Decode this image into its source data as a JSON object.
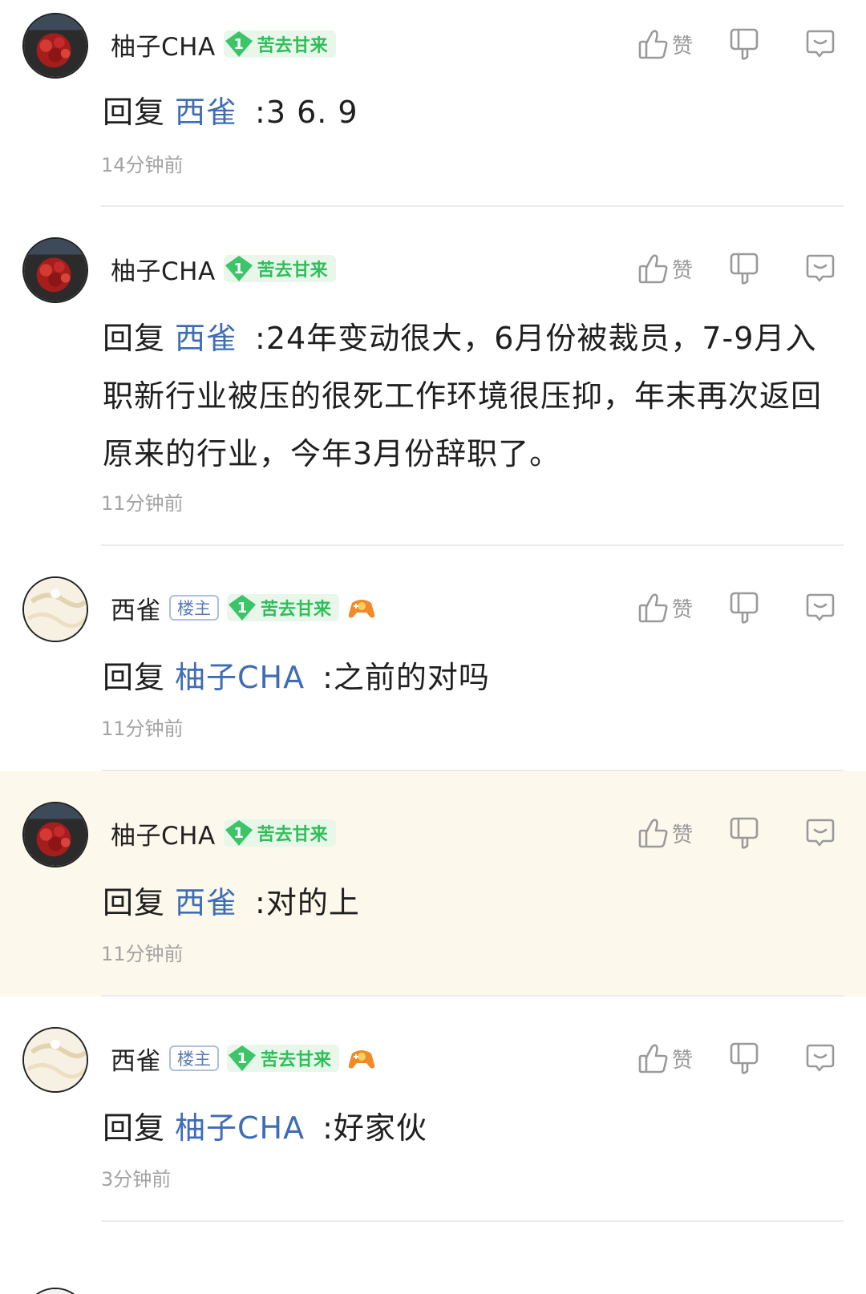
{
  "ui": {
    "reply_prefix": "回复",
    "like_label": "赞",
    "op_badge": "楼主"
  },
  "comments": [
    {
      "user": "柚子CHA",
      "level": "1",
      "level_title": "苦去甘来",
      "is_op": false,
      "reply_to": "西雀",
      "text": ":3 6. 9",
      "time": "14分钟前",
      "highlighted": false
    },
    {
      "user": "柚子CHA",
      "level": "1",
      "level_title": "苦去甘来",
      "is_op": false,
      "reply_to": "西雀",
      "text": ":24年变动很大，6月份被裁员，7-9月入职新行业被压的很死工作环境很压抑，年末再次返回原来的行业，今年3月份辞职了。",
      "time": "11分钟前",
      "highlighted": false
    },
    {
      "user": "西雀",
      "level": "1",
      "level_title": "苦去甘来",
      "is_op": true,
      "reply_to": "柚子CHA",
      "text": ":之前的对吗",
      "time": "11分钟前",
      "highlighted": false
    },
    {
      "user": "柚子CHA",
      "level": "1",
      "level_title": "苦去甘来",
      "is_op": false,
      "reply_to": "西雀",
      "text": ":对的上",
      "time": "11分钟前",
      "highlighted": true
    },
    {
      "user": "西雀",
      "level": "1",
      "level_title": "苦去甘来",
      "is_op": true,
      "reply_to": "柚子CHA",
      "text": ":好家伙",
      "time": "3分钟前",
      "highlighted": false
    }
  ],
  "colors": {
    "mention": "#3f6db5",
    "level_green": "#2fbf5a",
    "highlight_bg": "#fdf8ec"
  }
}
